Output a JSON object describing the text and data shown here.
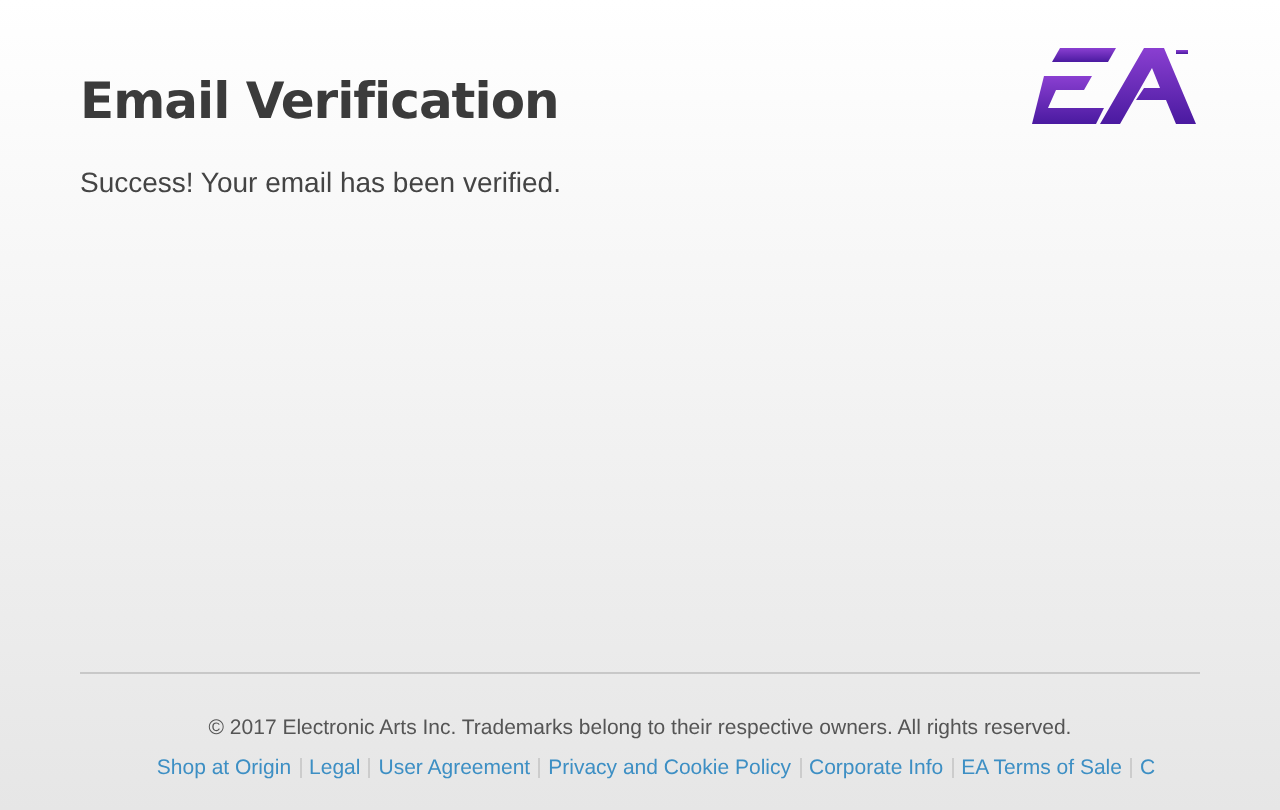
{
  "header": {
    "title": "Email Verification",
    "message": "Success! Your email has been verified."
  },
  "footer": {
    "copyright": "© 2017 Electronic Arts Inc. Trademarks belong to their respective owners. All rights reserved.",
    "links": [
      "Shop at Origin",
      "Legal",
      "User Agreement",
      "Privacy and Cookie Policy",
      "Corporate Info",
      "EA Terms of Sale",
      "C"
    ]
  }
}
